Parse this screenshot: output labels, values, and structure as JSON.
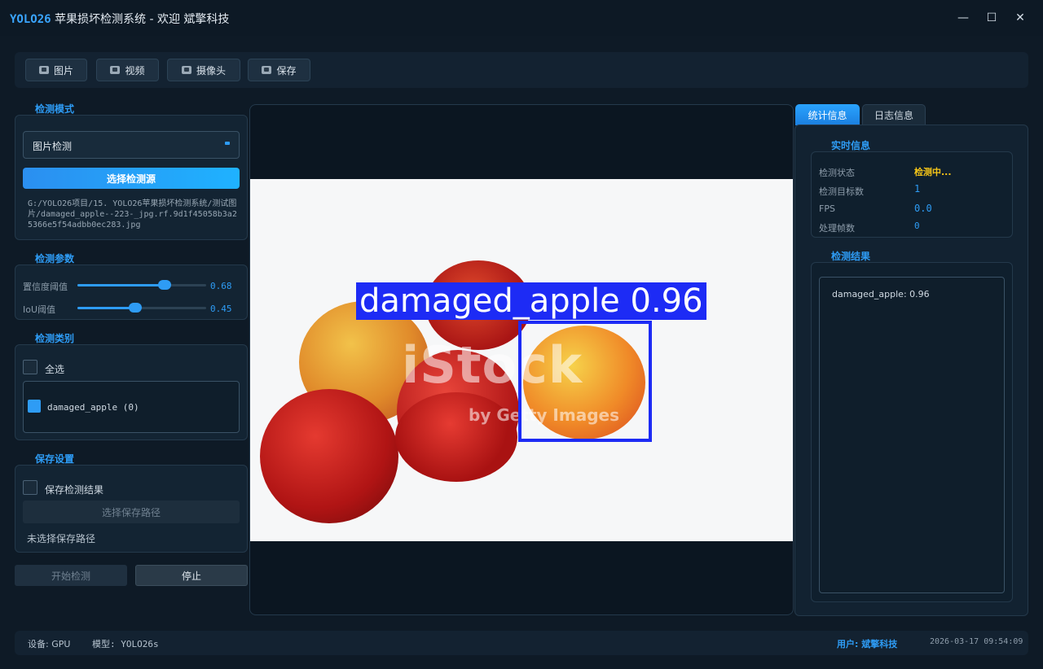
{
  "window": {
    "brand": "YOLO26",
    "title_rest": " 苹果损坏检测系统 - 欢迎 斌擎科技",
    "minimize": "—",
    "maximize": "☐",
    "close": "✕"
  },
  "toolbar": {
    "image": "图片",
    "video": "视频",
    "camera": "摄像头",
    "save": "保存"
  },
  "detect_mode": {
    "title": "检测模式",
    "selected": "图片检测",
    "choose_source": "选择检测源",
    "path": "G:/YOLO26项目/15. YOLO26苹果损坏检测系统/测试图片/damaged_apple--223-_jpg.rf.9d1f45058b3a25366e5f54adbb0ec283.jpg"
  },
  "params": {
    "title": "检测参数",
    "conf_label": "置信度阈值",
    "conf_value": "0.68",
    "conf_fraction": 0.68,
    "iou_label": "IoU阈值",
    "iou_value": "0.45",
    "iou_fraction": 0.45
  },
  "classes": {
    "title": "检测类别",
    "select_all": "全选",
    "items": [
      {
        "label": "damaged_apple (0)",
        "checked": true
      }
    ]
  },
  "save_settings": {
    "title": "保存设置",
    "save_results": "保存检测结果",
    "choose_path": "选择保存路径",
    "path_status": "未选择保存路径"
  },
  "actions": {
    "start": "开始检测",
    "stop": "停止"
  },
  "image_view": {
    "detection_label": "damaged_apple 0.96",
    "watermark": "iStock",
    "watermark_sub": "by Getty Images"
  },
  "tabs": {
    "stats": "统计信息",
    "log": "日志信息"
  },
  "realtime": {
    "title": "实时信息",
    "status_key": "检测状态",
    "status_val": "检测中...",
    "count_key": "检测目标数",
    "count_val": "1",
    "fps_key": "FPS",
    "fps_val": "0.0",
    "frames_key": "处理帧数",
    "frames_val": "0"
  },
  "results": {
    "title": "检测结果",
    "items": [
      "damaged_apple: 0.96"
    ]
  },
  "status_bar": {
    "device": "设备: GPU",
    "model": "模型: YOLO26s",
    "user": "用户: 斌擎科技",
    "datetime": "2026-03-17 09:54:09"
  },
  "colors": {
    "accent": "#2e9cf5",
    "warning": "#f5c518",
    "detection": "#1d2bf5",
    "background": "#0e1a26"
  }
}
